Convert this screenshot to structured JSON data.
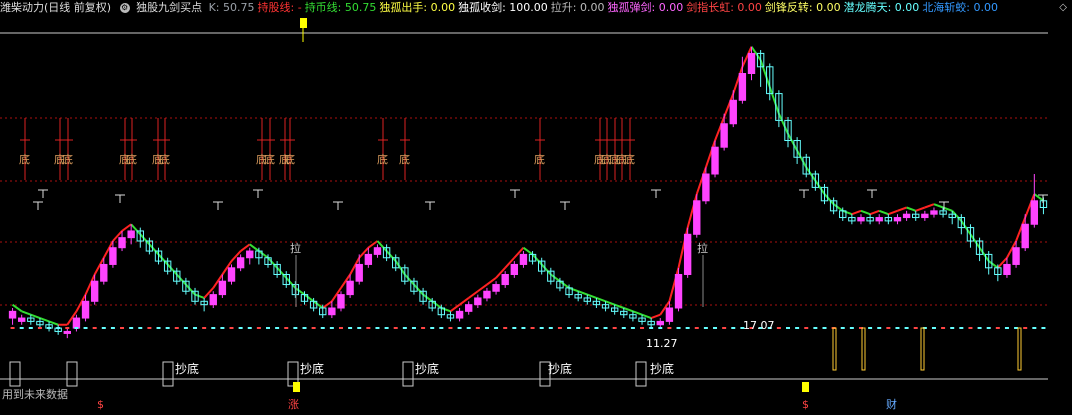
{
  "header": {
    "stock_title": "潍柴动力(日线 前复权)",
    "indicator_name": "独股九剑买点",
    "items": [
      {
        "label": "K:",
        "value": "50.75",
        "color": "#9aa0a8"
      },
      {
        "label": "持股线:",
        "value": "-",
        "color": "#ff3333"
      },
      {
        "label": "持币线:",
        "value": "50.75",
        "color": "#33dd33"
      },
      {
        "label": "独孤出手:",
        "value": "0.00",
        "color": "#ffff44"
      },
      {
        "label": "独孤收剑:",
        "value": "100.00",
        "color": "#ffffff"
      },
      {
        "label": "拉升:",
        "value": "0.00",
        "color": "#bbbbbb"
      },
      {
        "label": "独孤弹剑:",
        "value": "0.00",
        "color": "#ff66ff"
      },
      {
        "label": "剑指长虹:",
        "value": "0.00",
        "color": "#ff4444"
      },
      {
        "label": "剑锋反转:",
        "value": "0.00",
        "color": "#ffff66"
      },
      {
        "label": "潜龙腾天:",
        "value": "0.00",
        "color": "#66ffff"
      },
      {
        "label": "北海斩蛟:",
        "value": "0.00",
        "color": "#3399ff"
      }
    ]
  },
  "footer_note": "用到未来数据",
  "colors": {
    "up": "#ff44ff",
    "down": "#66ffff",
    "hold": "#ff2222",
    "cash": "#33dd33",
    "grid": "#aa1111"
  },
  "signals": {
    "di": "底",
    "chaodi": "抄底",
    "la": "拉",
    "zhang": "涨",
    "cai": "财",
    "dollar": "$",
    "price_low": "11.27",
    "price_high": "17.07"
  },
  "chart_data": {
    "type": "candlestick",
    "y_scale": "normalized 0-100",
    "grid": "dashed red horizontal",
    "candles": [
      [
        17,
        19,
        15,
        20
      ],
      [
        16,
        17,
        15,
        18
      ],
      [
        17,
        16,
        15,
        18
      ],
      [
        16,
        15,
        14,
        17
      ],
      [
        15,
        14,
        13,
        16
      ],
      [
        14,
        13,
        12,
        15
      ],
      [
        13,
        13,
        11,
        14
      ],
      [
        14,
        17,
        13,
        18
      ],
      [
        17,
        22,
        16,
        24
      ],
      [
        22,
        28,
        21,
        30
      ],
      [
        28,
        33,
        27,
        35
      ],
      [
        33,
        38,
        32,
        40
      ],
      [
        38,
        41,
        37,
        43
      ],
      [
        41,
        43,
        39,
        45
      ],
      [
        43,
        40,
        38,
        44
      ],
      [
        40,
        37,
        36,
        41
      ],
      [
        37,
        34,
        33,
        38
      ],
      [
        34,
        31,
        30,
        35
      ],
      [
        31,
        28,
        27,
        32
      ],
      [
        28,
        25,
        24,
        29
      ],
      [
        25,
        22,
        21,
        26
      ],
      [
        22,
        21,
        19,
        23
      ],
      [
        21,
        24,
        20,
        25
      ],
      [
        24,
        28,
        23,
        30
      ],
      [
        28,
        32,
        27,
        33
      ],
      [
        32,
        35,
        31,
        36
      ],
      [
        35,
        37,
        33,
        38
      ],
      [
        37,
        35,
        33,
        38
      ],
      [
        35,
        33,
        32,
        36
      ],
      [
        33,
        30,
        29,
        34
      ],
      [
        30,
        27,
        26,
        31
      ],
      [
        27,
        24,
        23,
        28
      ],
      [
        24,
        22,
        21,
        25
      ],
      [
        22,
        20,
        19,
        23
      ],
      [
        20,
        18,
        17,
        21
      ],
      [
        18,
        20,
        17,
        22
      ],
      [
        20,
        24,
        19,
        25
      ],
      [
        24,
        28,
        23,
        30
      ],
      [
        28,
        33,
        27,
        36
      ],
      [
        33,
        36,
        32,
        38
      ],
      [
        36,
        38,
        35,
        39
      ],
      [
        38,
        35,
        34,
        39
      ],
      [
        35,
        32,
        31,
        36
      ],
      [
        32,
        28,
        27,
        33
      ],
      [
        28,
        25,
        24,
        29
      ],
      [
        25,
        22,
        21,
        26
      ],
      [
        22,
        20,
        19,
        23
      ],
      [
        20,
        18,
        17,
        21
      ],
      [
        18,
        17,
        16,
        19
      ],
      [
        17,
        19,
        16,
        20
      ],
      [
        19,
        21,
        18,
        22
      ],
      [
        21,
        23,
        20,
        24
      ],
      [
        23,
        25,
        22,
        26
      ],
      [
        25,
        27,
        24,
        28
      ],
      [
        27,
        30,
        26,
        31
      ],
      [
        30,
        33,
        29,
        34
      ],
      [
        33,
        36,
        32,
        37
      ],
      [
        36,
        34,
        33,
        37
      ],
      [
        34,
        31,
        30,
        35
      ],
      [
        31,
        28,
        27,
        32
      ],
      [
        28,
        26,
        25,
        29
      ],
      [
        26,
        24,
        23,
        27
      ],
      [
        24,
        23,
        22,
        25
      ],
      [
        23,
        22,
        21,
        24
      ],
      [
        22,
        21,
        20,
        23
      ],
      [
        21,
        20,
        19,
        22
      ],
      [
        20,
        19,
        18,
        21
      ],
      [
        19,
        18,
        17,
        20
      ],
      [
        18,
        17,
        16,
        19
      ],
      [
        17,
        16,
        15,
        18
      ],
      [
        16,
        15,
        14,
        17
      ],
      [
        15,
        16,
        14,
        17
      ],
      [
        16,
        20,
        15,
        22
      ],
      [
        20,
        30,
        19,
        32
      ],
      [
        30,
        42,
        29,
        44
      ],
      [
        42,
        52,
        41,
        54
      ],
      [
        52,
        60,
        51,
        62
      ],
      [
        60,
        68,
        59,
        70
      ],
      [
        68,
        75,
        67,
        78
      ],
      [
        75,
        82,
        74,
        85
      ],
      [
        82,
        90,
        81,
        95
      ],
      [
        90,
        96,
        88,
        98
      ],
      [
        96,
        92,
        86,
        97
      ],
      [
        92,
        84,
        82,
        93
      ],
      [
        84,
        76,
        74,
        85
      ],
      [
        76,
        70,
        68,
        77
      ],
      [
        70,
        65,
        63,
        71
      ],
      [
        65,
        60,
        59,
        66
      ],
      [
        60,
        56,
        55,
        61
      ],
      [
        56,
        52,
        51,
        57
      ],
      [
        52,
        49,
        48,
        53
      ],
      [
        49,
        47,
        46,
        50
      ],
      [
        47,
        46,
        45,
        48
      ],
      [
        46,
        47,
        45,
        48
      ],
      [
        47,
        46,
        45,
        48
      ],
      [
        46,
        47,
        45,
        48
      ],
      [
        47,
        46,
        45,
        48
      ],
      [
        46,
        47,
        45,
        48
      ],
      [
        47,
        48,
        46,
        49
      ],
      [
        48,
        47,
        46,
        49
      ],
      [
        47,
        48,
        46,
        49
      ],
      [
        48,
        49,
        47,
        50
      ],
      [
        49,
        48,
        47,
        50
      ],
      [
        48,
        47,
        45,
        49
      ],
      [
        47,
        44,
        42,
        48
      ],
      [
        44,
        40,
        38,
        45
      ],
      [
        40,
        36,
        34,
        41
      ],
      [
        36,
        32,
        30,
        37
      ],
      [
        32,
        30,
        28,
        33
      ],
      [
        30,
        33,
        29,
        35
      ],
      [
        33,
        38,
        32,
        40
      ],
      [
        38,
        45,
        37,
        48
      ],
      [
        45,
        52,
        44,
        60
      ],
      [
        52,
        50,
        48,
        53
      ]
    ],
    "hold_line": "red segments (uptrend)",
    "cash_line": "green segments (downtrend)",
    "annotations": [
      "11.27",
      "17.07"
    ]
  }
}
